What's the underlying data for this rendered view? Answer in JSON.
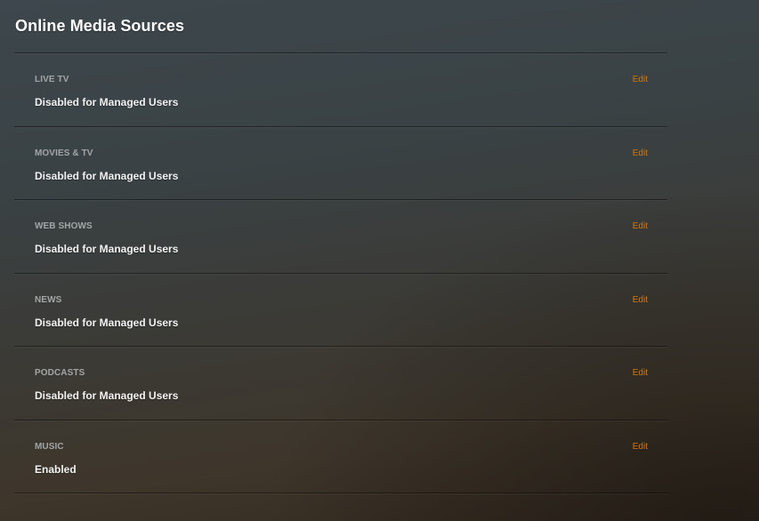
{
  "page": {
    "title": "Online Media Sources"
  },
  "theme": {
    "accent": "#cc7b19",
    "label_color": "#a3a6a6",
    "text_color": "#f2f2f2"
  },
  "sources": [
    {
      "label": "LIVE TV",
      "value": "Disabled for Managed Users",
      "action": "Edit"
    },
    {
      "label": "MOVIES & TV",
      "value": "Disabled for Managed Users",
      "action": "Edit"
    },
    {
      "label": "WEB SHOWS",
      "value": "Disabled for Managed Users",
      "action": "Edit"
    },
    {
      "label": "NEWS",
      "value": "Disabled for Managed Users",
      "action": "Edit"
    },
    {
      "label": "PODCASTS",
      "value": "Disabled for Managed Users",
      "action": "Edit"
    },
    {
      "label": "MUSIC",
      "value": "Enabled",
      "action": "Edit"
    }
  ]
}
